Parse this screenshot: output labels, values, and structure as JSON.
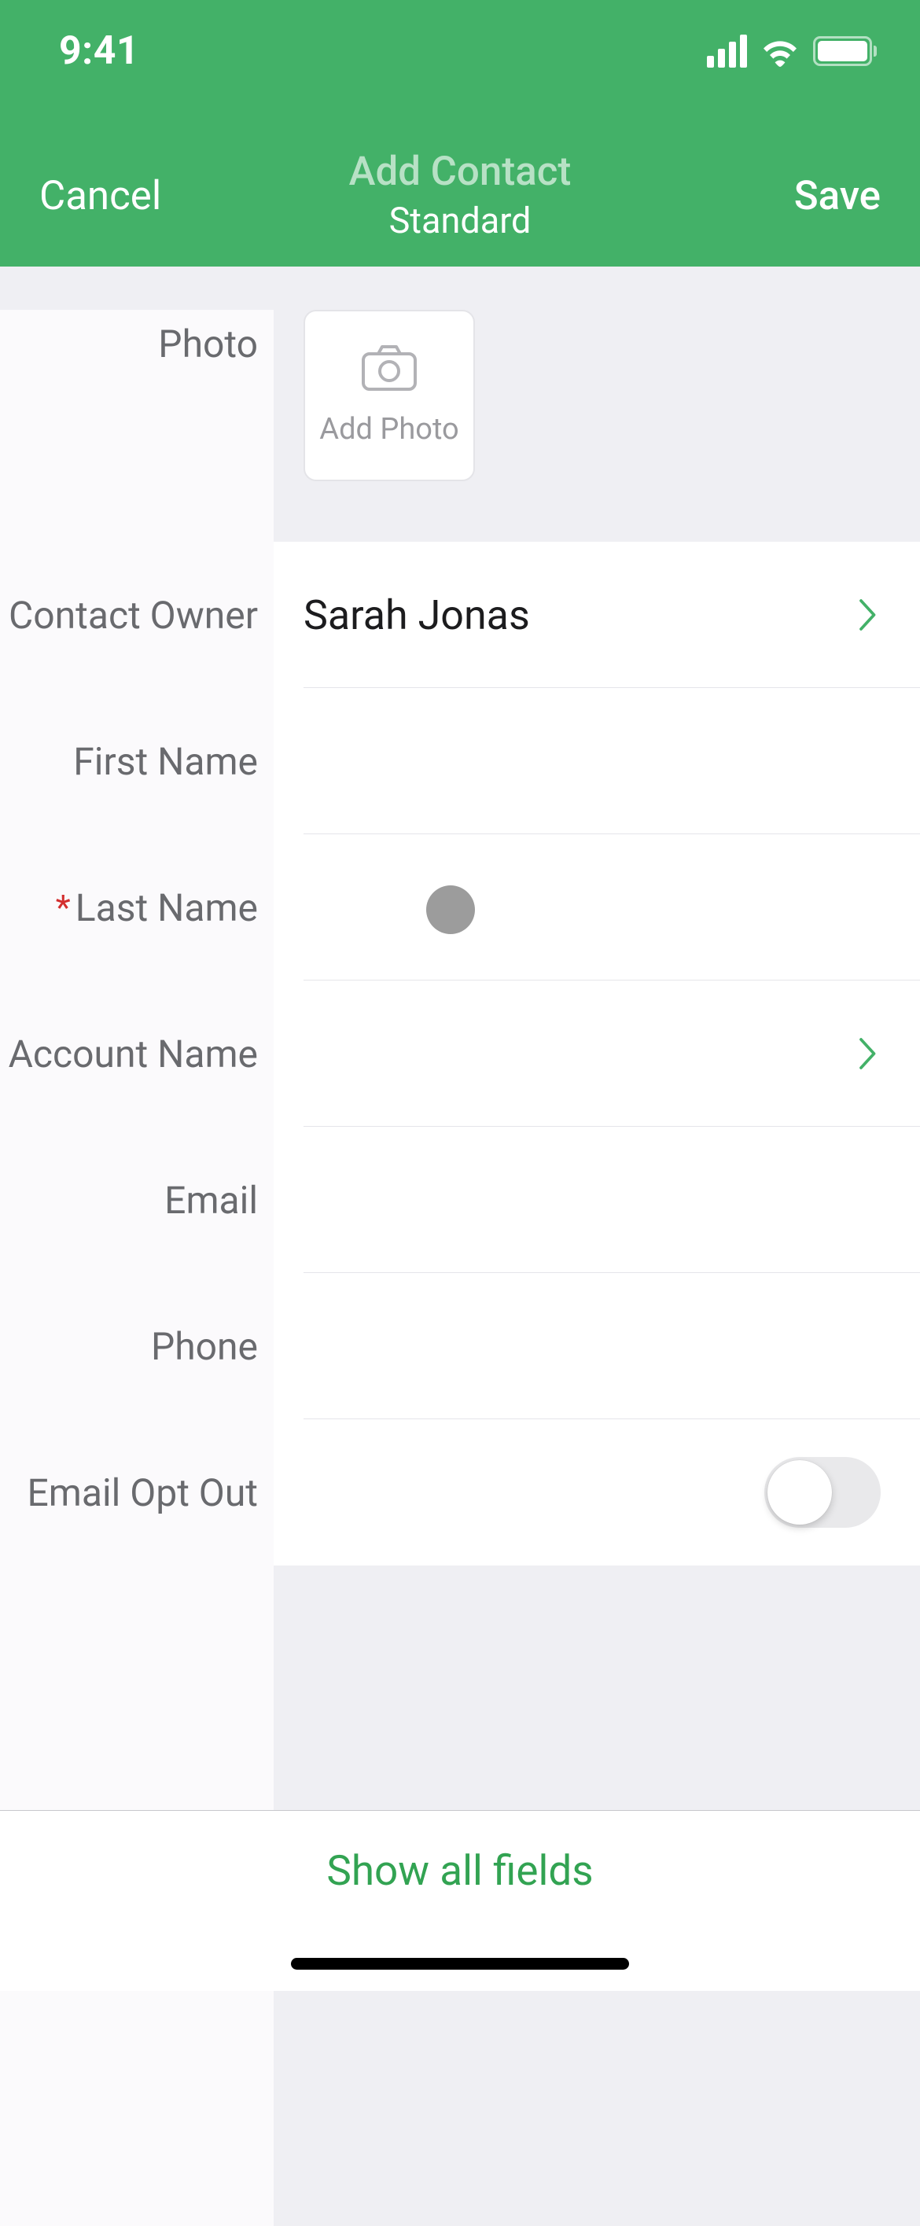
{
  "status": {
    "time": "9:41"
  },
  "nav": {
    "cancel": "Cancel",
    "title": "Add Contact",
    "subtitle": "Standard",
    "save": "Save"
  },
  "fields": {
    "photo": {
      "label": "Photo",
      "placeholder": "Add Photo"
    },
    "owner": {
      "label": "Contact Owner",
      "value": "Sarah Jonas"
    },
    "first_name": {
      "label": "First Name",
      "value": ""
    },
    "last_name": {
      "label": "Last Name",
      "value": "",
      "required": true
    },
    "account_name": {
      "label": "Account Name",
      "value": ""
    },
    "email": {
      "label": "Email",
      "value": ""
    },
    "phone": {
      "label": "Phone",
      "value": ""
    },
    "email_opt_out": {
      "label": "Email Opt Out",
      "value": false
    }
  },
  "footer": {
    "show_all": "Show all fields"
  }
}
